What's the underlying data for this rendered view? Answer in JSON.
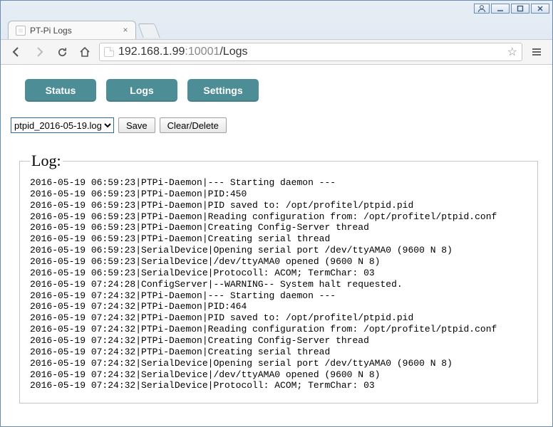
{
  "window": {
    "tab_title": "PT-Pi Logs",
    "url_host": "192.168.1.99",
    "url_port": ":10001",
    "url_path": "/Logs"
  },
  "nav": {
    "status": "Status",
    "logs": "Logs",
    "settings": "Settings"
  },
  "controls": {
    "selected_log": "ptpid_2016-05-19.log",
    "save": "Save",
    "clear": "Clear/Delete"
  },
  "logbox": {
    "legend": "Log:",
    "lines": [
      "2016-05-19 06:59:23|PTPi-Daemon|--- Starting daemon ---",
      "2016-05-19 06:59:23|PTPi-Daemon|PID:450",
      "2016-05-19 06:59:23|PTPi-Daemon|PID saved to: /opt/profitel/ptpid.pid",
      "2016-05-19 06:59:23|PTPi-Daemon|Reading configuration from: /opt/profitel/ptpid.conf",
      "2016-05-19 06:59:23|PTPi-Daemon|Creating Config-Server thread",
      "2016-05-19 06:59:23|PTPi-Daemon|Creating serial thread",
      "2016-05-19 06:59:23|SerialDevice|Opening serial port /dev/ttyAMA0 (9600 N 8)",
      "2016-05-19 06:59:23|SerialDevice|/dev/ttyAMA0 opened (9600 N 8)",
      "2016-05-19 06:59:23|SerialDevice|Protocoll: ACOM; TermChar: 03",
      "2016-05-19 07:24:28|ConfigServer|--WARNING-- System halt requested.",
      "2016-05-19 07:24:32|PTPi-Daemon|--- Starting daemon ---",
      "2016-05-19 07:24:32|PTPi-Daemon|PID:464",
      "2016-05-19 07:24:32|PTPi-Daemon|PID saved to: /opt/profitel/ptpid.pid",
      "2016-05-19 07:24:32|PTPi-Daemon|Reading configuration from: /opt/profitel/ptpid.conf",
      "2016-05-19 07:24:32|PTPi-Daemon|Creating Config-Server thread",
      "2016-05-19 07:24:32|PTPi-Daemon|Creating serial thread",
      "2016-05-19 07:24:32|SerialDevice|Opening serial port /dev/ttyAMA0 (9600 N 8)",
      "2016-05-19 07:24:32|SerialDevice|/dev/ttyAMA0 opened (9600 N 8)",
      "2016-05-19 07:24:32|SerialDevice|Protocoll: ACOM; TermChar: 03"
    ]
  }
}
